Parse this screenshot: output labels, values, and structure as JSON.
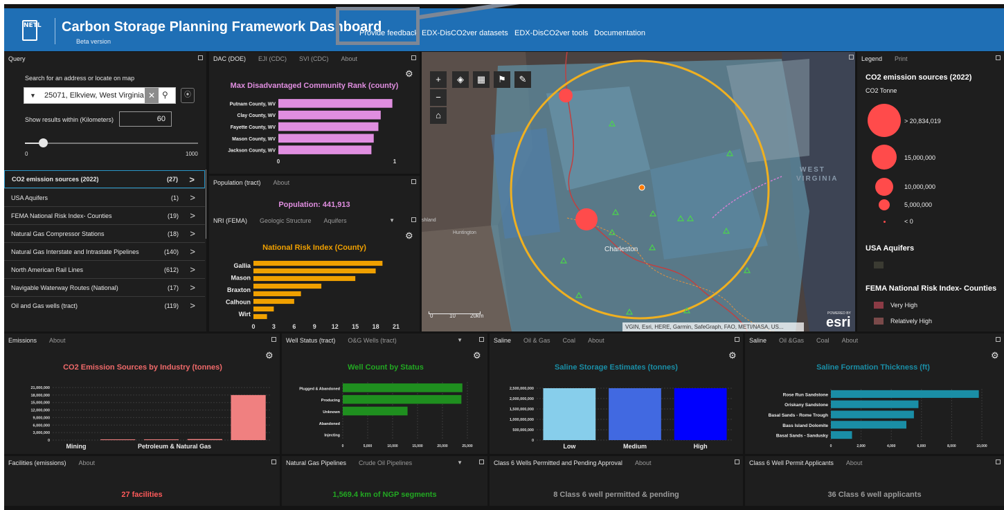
{
  "header": {
    "logo_text": "NETL",
    "title": "Carbon Storage Planning Framework Dashboard",
    "subtitle": "Beta version",
    "nav": [
      "Provide feedback",
      "EDX-DisCO2ver datasets",
      "EDX-DisCO2ver tools",
      "Documentation"
    ]
  },
  "query": {
    "tab": "Query",
    "search_label": "Search for an address or locate on map",
    "search_value": "25071, Elkview, West Virginia",
    "radius_label": "Show results within (Kilometers)",
    "radius_value": "60",
    "slider_value": 60,
    "slider_min": "0",
    "slider_max": "1000",
    "rows": [
      {
        "label": "CO2 emission sources (2022)",
        "count": "(27)"
      },
      {
        "label": "USA Aquifers",
        "count": "(1)"
      },
      {
        "label": "FEMA National Risk Index- Counties",
        "count": "(19)"
      },
      {
        "label": "Natural Gas Compressor Stations",
        "count": "(18)"
      },
      {
        "label": "Natural Gas Interstate and Intrastate Pipelines",
        "count": "(140)"
      },
      {
        "label": "North American Rail Lines",
        "count": "(612)"
      },
      {
        "label": "Navigable Waterway Routes (National)",
        "count": "(17)"
      },
      {
        "label": "Oil and Gas wells (tract)",
        "count": "(119)"
      }
    ]
  },
  "dac": {
    "tabs": [
      "DAC (DOE)",
      "EJI (CDC)",
      "SVI (CDC)",
      "About"
    ]
  },
  "population": {
    "tabs": [
      "Population (tract)",
      "About"
    ],
    "text": "Population: 441,913"
  },
  "nri": {
    "tabs": [
      "NRI (FEMA)",
      "Geologic Structure",
      "Aquifers"
    ]
  },
  "map": {
    "labels": [
      "WEST",
      "VIRGINIA",
      "Charleston",
      "Huntington",
      "shland"
    ],
    "scale_labels": [
      "0",
      "10",
      "20km"
    ],
    "attribution": "VGIN, Esri, HERE, Garmin, SafeGraph, FAO, METI/NASA, US...",
    "esri_powered": "POWERED BY",
    "esri": "esri"
  },
  "legend": {
    "tabs": [
      "Legend",
      "Print"
    ],
    "title": "CO2 emission sources (2022)",
    "unit": "CO2 Tonne",
    "sizes": [
      "> 20,834,019",
      "15,000,000",
      "10,000,000",
      "5,000,000",
      "< 0"
    ],
    "aquifers_title": "USA Aquifers",
    "fema_title": "FEMA National Risk Index- Counties",
    "fema_items": [
      "Very High",
      "Relatively High"
    ],
    "colors": {
      "circle": "#ff4b4b",
      "aquifer": "#3b3b32",
      "very_high": "#8b3b45",
      "relatively_high": "#7a4a4a"
    }
  },
  "emissions": {
    "tabs": [
      "Emissions",
      "About"
    ]
  },
  "wells": {
    "tabs": [
      "Well Status (tract)",
      "O&G Wells (tract)"
    ]
  },
  "saline": {
    "tabs": [
      "Saline",
      "Oil & Gas",
      "Coal",
      "About"
    ]
  },
  "thickness": {
    "tabs": [
      "Saline",
      "Oil &Gas",
      "Coal",
      "About"
    ]
  },
  "facilities": {
    "tabs": [
      "Facilities (emissions)",
      "About"
    ],
    "text": "27 facilities"
  },
  "pipelines": {
    "tabs": [
      "Natural Gas Pipelines",
      "Crude Oil Pipelines"
    ],
    "text": "1,569.4 km of NGP segments"
  },
  "class6": {
    "tabs": [
      "Class 6 Wells Permitted and Pending Approval",
      "About"
    ],
    "text": "8 Class 6 well permitted & pending"
  },
  "class6apps": {
    "tabs": [
      "Class 6 Well Permit Applicants",
      "About"
    ],
    "text": "36 Class 6 well applicants"
  },
  "chart_data": [
    {
      "type": "bar",
      "orientation": "horizontal",
      "title": "Max Disadvantaged Community Rank (county)",
      "categories": [
        "Putnam County, WV",
        "Clay County, WV",
        "Fayette County, WV",
        "Mason County, WV",
        "Jackson County, WV"
      ],
      "values": [
        0.98,
        0.88,
        0.86,
        0.82,
        0.8
      ],
      "xlim": [
        0,
        1
      ],
      "ticks": [
        "0",
        "1"
      ],
      "color": "#e08ee0"
    },
    {
      "type": "bar",
      "orientation": "horizontal",
      "title": "National Risk Index (County)",
      "categories": [
        "Gallia",
        "Mason",
        "Braxton",
        "Calhoun",
        "Wirt"
      ],
      "values": [
        19,
        18,
        15,
        10,
        7,
        6,
        3,
        2
      ],
      "xlim": [
        0,
        21
      ],
      "ticks": [
        "0",
        "3",
        "6",
        "9",
        "12",
        "15",
        "18",
        "21"
      ],
      "color": "#f0a000"
    },
    {
      "type": "bar",
      "title": "CO2 Emission Sources by Industry (tonnes)",
      "categories": [
        "Mining",
        "Petroleum & Natural Gas"
      ],
      "values": [
        0,
        300000,
        300000,
        400000,
        18000000
      ],
      "ylim": [
        0,
        21000000
      ],
      "ticks": [
        "0",
        "3,000,000",
        "6,000,000",
        "9,000,000",
        "12,000,000",
        "15,000,000",
        "18,000,000",
        "21,000,000"
      ],
      "color": "#f08080"
    },
    {
      "type": "bar",
      "orientation": "horizontal",
      "title": "Well Count by Status",
      "categories": [
        "Plugged & Abandoned",
        "Producing",
        "Unknown",
        "Abandoned",
        "Injecting"
      ],
      "values": [
        24000,
        23800,
        13000,
        0,
        0
      ],
      "xlim": [
        0,
        25000
      ],
      "ticks": [
        "0",
        "5,000",
        "10,000",
        "15,000",
        "20,000",
        "25,000"
      ],
      "color": "#1f8f1f"
    },
    {
      "type": "bar",
      "title": "Saline Storage Estimates (tonnes)",
      "categories": [
        "Low",
        "Medium",
        "High"
      ],
      "values": [
        2500000000,
        2500000000,
        2500000000
      ],
      "ylim": [
        0,
        2800000000
      ],
      "ticks": [
        "0",
        "500,000,000",
        "1,000,000,000",
        "1,500,000,000",
        "2,000,000,000",
        "2,500,000,000"
      ],
      "colors": [
        "#87ceeb",
        "#4169e1",
        "#0000ff"
      ]
    },
    {
      "type": "bar",
      "orientation": "horizontal",
      "title": "Saline Formation Thickness (ft)",
      "categories": [
        "Rose Run Sandstone",
        "Oriskany Sandstone",
        "Basal Sands - Rome Trough",
        "Bass Island Dolomite",
        "Basal Sands - Sandusky"
      ],
      "values": [
        9800,
        5800,
        5500,
        5000,
        1400
      ],
      "xlim": [
        0,
        10000
      ],
      "ticks": [
        "0",
        "2,000",
        "4,000",
        "6,000",
        "8,000",
        "10,000"
      ],
      "color": "#1a8ea6"
    }
  ]
}
